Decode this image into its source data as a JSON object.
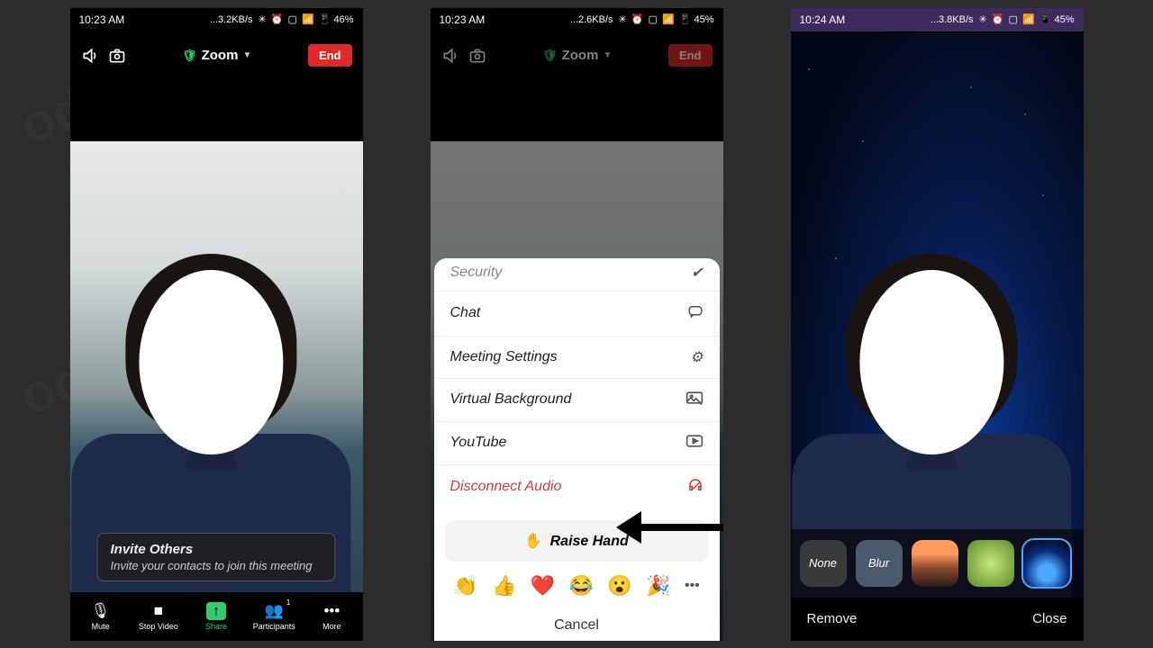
{
  "screens": [
    {
      "status": {
        "time": "10:23 AM",
        "net": "...3.2KB/s",
        "battery": "46%"
      },
      "toolbar": {
        "app": "Zoom",
        "end": "End"
      },
      "invite": {
        "title": "Invite Others",
        "sub": "Invite your contacts to join this meeting"
      },
      "bottom": {
        "mute": "Mute",
        "stop": "Stop Video",
        "share": "Share",
        "participants": "Participants",
        "part_count": "1",
        "more": "More"
      }
    },
    {
      "status": {
        "time": "10:23 AM",
        "net": "...2.6KB/s",
        "battery": "45%"
      },
      "toolbar": {
        "app": "Zoom",
        "end": "End"
      },
      "sheet": {
        "security": "Security",
        "chat": "Chat",
        "settings": "Meeting Settings",
        "vb": "Virtual Background",
        "youtube": "YouTube",
        "disconnect": "Disconnect Audio",
        "raise": "Raise Hand",
        "cancel": "Cancel",
        "emojis": [
          "👏",
          "👍",
          "❤️",
          "😂",
          "😮",
          "🎉"
        ]
      }
    },
    {
      "status": {
        "time": "10:24 AM",
        "net": "...3.8KB/s",
        "battery": "45%"
      },
      "vb": {
        "none": "None",
        "blur": "Blur",
        "remove": "Remove",
        "close": "Close"
      }
    }
  ],
  "status_icons": "✳ ⏰ ▢ 📶 📱"
}
